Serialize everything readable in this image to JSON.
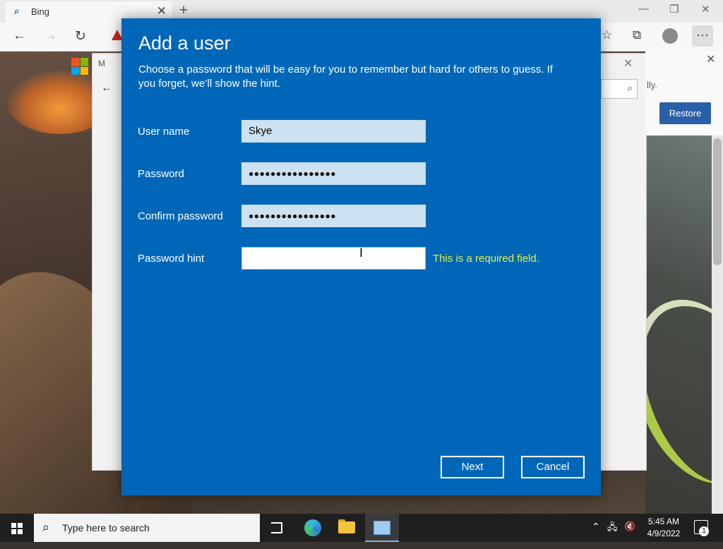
{
  "browser": {
    "tab_title": "Bing",
    "tab_close_glyph": "✕",
    "new_tab_glyph": "+",
    "window_controls": [
      "—",
      "❐",
      "✕"
    ],
    "back_glyph": "←",
    "forward_glyph": "→",
    "refresh_glyph": "↻",
    "favorites_glyph": "☆",
    "collections_glyph": "⧉",
    "more_glyph": "···"
  },
  "settings_window": {
    "title_fragment": "M",
    "back_glyph": "←",
    "close_glyph": "✕",
    "search_glyph": "⌕"
  },
  "side_panel": {
    "close_glyph": "✕",
    "text_fragment": "lly.",
    "restore_label": "Restore"
  },
  "dialog": {
    "title": "Add a user",
    "description": "Choose a password that will be easy for you to remember but hard for others to guess. If you forget, we’ll show the hint.",
    "fields": {
      "username": {
        "label": "User name",
        "value": "Skye"
      },
      "password": {
        "label": "Password",
        "value": "●●●●●●●●●●●●●●●●"
      },
      "confirm": {
        "label": "Confirm password",
        "value": "●●●●●●●●●●●●●●●●"
      },
      "hint": {
        "label": "Password hint",
        "value": "",
        "error": "This is a required field."
      }
    },
    "cursor_glyph": "I",
    "next_label": "Next",
    "cancel_label": "Cancel"
  },
  "taskbar": {
    "search_placeholder": "Type here to search",
    "search_glyph": "⌕",
    "tray_chevron": "⌃",
    "network_glyph": "🖧",
    "volume_glyph": "🔇",
    "time": "5:45 AM",
    "date": "4/9/2022",
    "notification_count": "1"
  },
  "colors": {
    "dialog_bg": "#0067b8",
    "error_text": "#e0f04a",
    "input_bg": "#cce1f1"
  }
}
